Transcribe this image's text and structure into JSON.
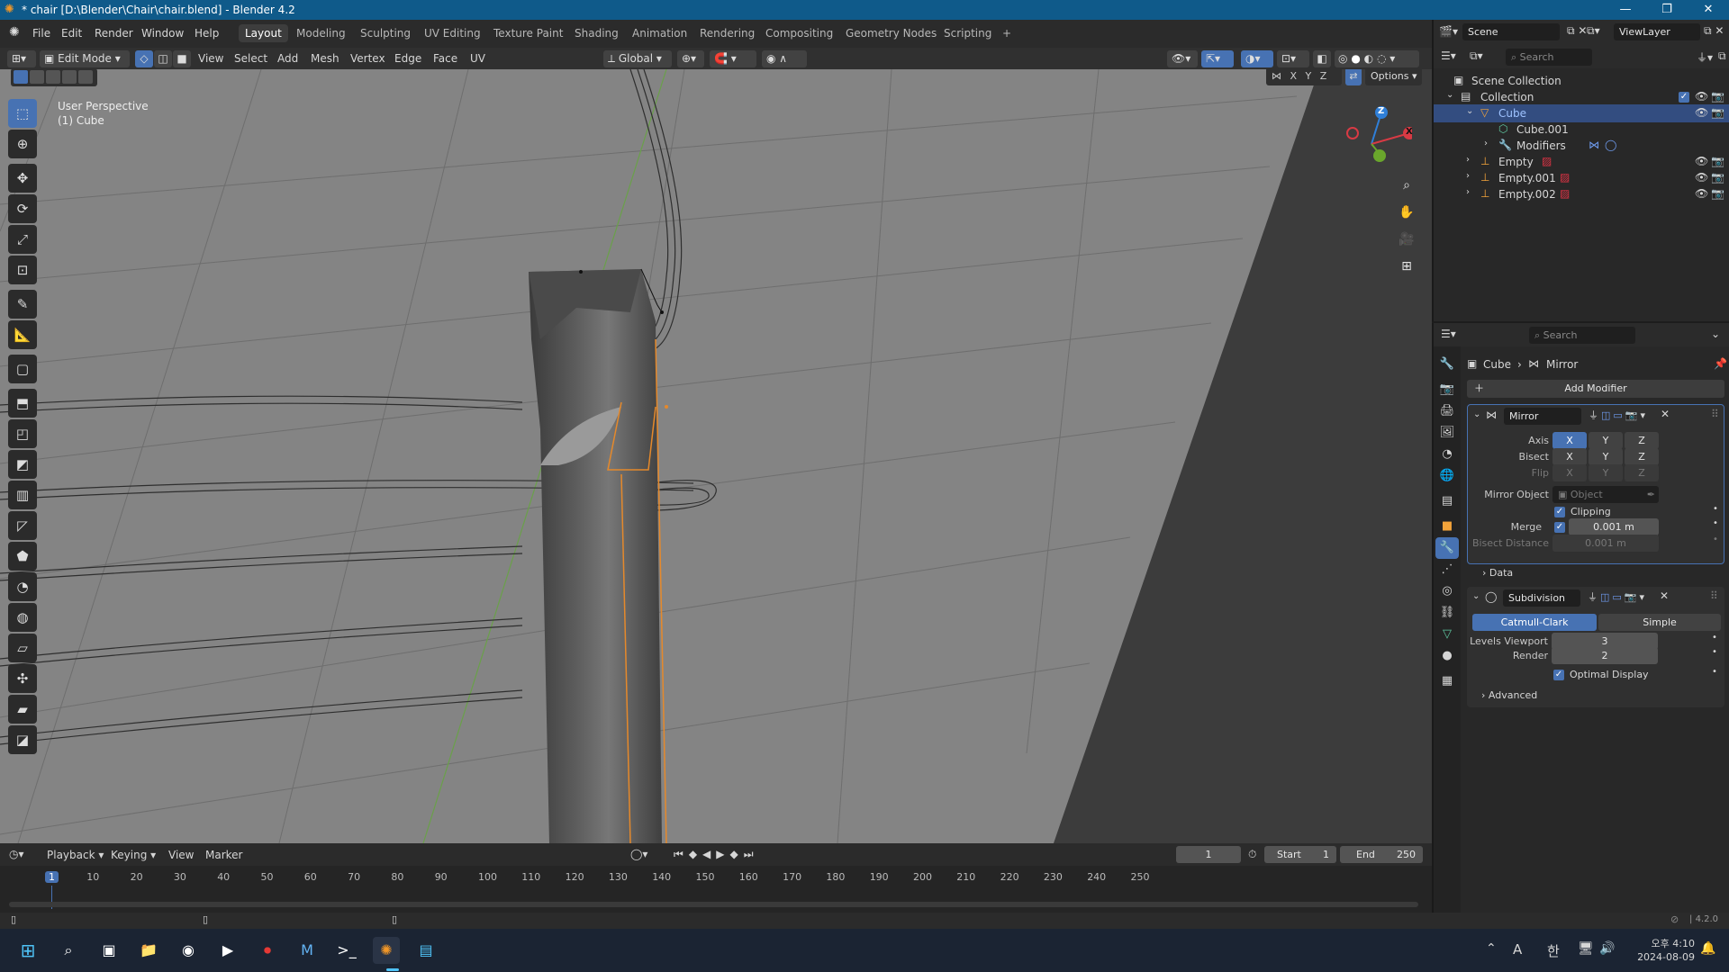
{
  "window": {
    "title": "* chair [D:\\Blender\\Chair\\chair.blend] - Blender 4.2",
    "minimize": "—",
    "maximize": "❐",
    "close": "✕"
  },
  "menu": {
    "items": [
      "File",
      "Edit",
      "Render",
      "Window",
      "Help"
    ]
  },
  "workspaces": {
    "tabs": [
      "Layout",
      "Modeling",
      "Sculpting",
      "UV Editing",
      "Texture Paint",
      "Shading",
      "Animation",
      "Rendering",
      "Compositing",
      "Geometry Nodes",
      "Scripting"
    ],
    "active": "Layout",
    "add": "+"
  },
  "scene": {
    "label": "Scene",
    "viewlayer": "ViewLayer"
  },
  "viewport_header": {
    "mode": "Edit Mode",
    "menus": [
      "View",
      "Select",
      "Add",
      "Mesh",
      "Vertex",
      "Edge",
      "Face",
      "UV"
    ],
    "orientation": "Global",
    "options": "Options",
    "axes": [
      "X",
      "Y",
      "Z"
    ]
  },
  "viewport": {
    "perspective": "User Perspective",
    "object": "(1) Cube",
    "gizmo": {
      "z": "Z",
      "x": "X"
    }
  },
  "outliner": {
    "search_placeholder": "Search",
    "scene_collection": "Scene Collection",
    "collection": "Collection",
    "items": [
      {
        "name": "Cube",
        "icon": "triangle-icon"
      },
      {
        "name": "Cube.001",
        "icon": "mesh-icon"
      },
      {
        "name": "Modifiers",
        "icon": "wrench-icon"
      },
      {
        "name": "Empty",
        "icon": "empty-icon"
      },
      {
        "name": "Empty.001",
        "icon": "empty-icon"
      },
      {
        "name": "Empty.002",
        "icon": "empty-icon"
      }
    ]
  },
  "properties": {
    "search_placeholder": "Search",
    "breadcrumb": {
      "object": "Cube",
      "modifier": "Mirror"
    },
    "add_modifier": "Add Modifier",
    "mirror": {
      "name": "Mirror",
      "axis_label": "Axis",
      "bisect_label": "Bisect",
      "flip_label": "Flip",
      "axes": [
        "X",
        "Y",
        "Z"
      ],
      "axis_active": "X",
      "mirror_object_label": "Mirror Object",
      "mirror_object_placeholder": "Object",
      "clipping": "Clipping",
      "merge_label": "Merge",
      "merge_value": "0.001 m",
      "bisect_distance_label": "Bisect Distance",
      "bisect_distance_value": "0.001 m",
      "data": "Data"
    },
    "subdivision": {
      "name": "Subdivision",
      "catmull": "Catmull-Clark",
      "simple": "Simple",
      "levels_viewport_label": "Levels Viewport",
      "levels_viewport": "3",
      "render_label": "Render",
      "render": "2",
      "optimal": "Optimal Display",
      "advanced": "Advanced"
    }
  },
  "timeline": {
    "menus": [
      "Playback",
      "Keying",
      "View",
      "Marker"
    ],
    "current_frame": "1",
    "start_label": "Start",
    "start": "1",
    "end_label": "End",
    "end": "250",
    "ticks": [
      "1",
      "10",
      "20",
      "30",
      "40",
      "50",
      "60",
      "70",
      "80",
      "90",
      "100",
      "110",
      "120",
      "130",
      "140",
      "150",
      "160",
      "170",
      "180",
      "190",
      "200",
      "210",
      "220",
      "230",
      "240",
      "250"
    ]
  },
  "status": {
    "version": "4.2.0"
  },
  "taskbar": {
    "time": "오후 4:10",
    "date": "2024-08-09",
    "ime": "A",
    "ime2": "한"
  },
  "colors": {
    "accent": "#4772b3",
    "title_bar": "#0f5a8a",
    "selection_orange": "#e5892b"
  }
}
